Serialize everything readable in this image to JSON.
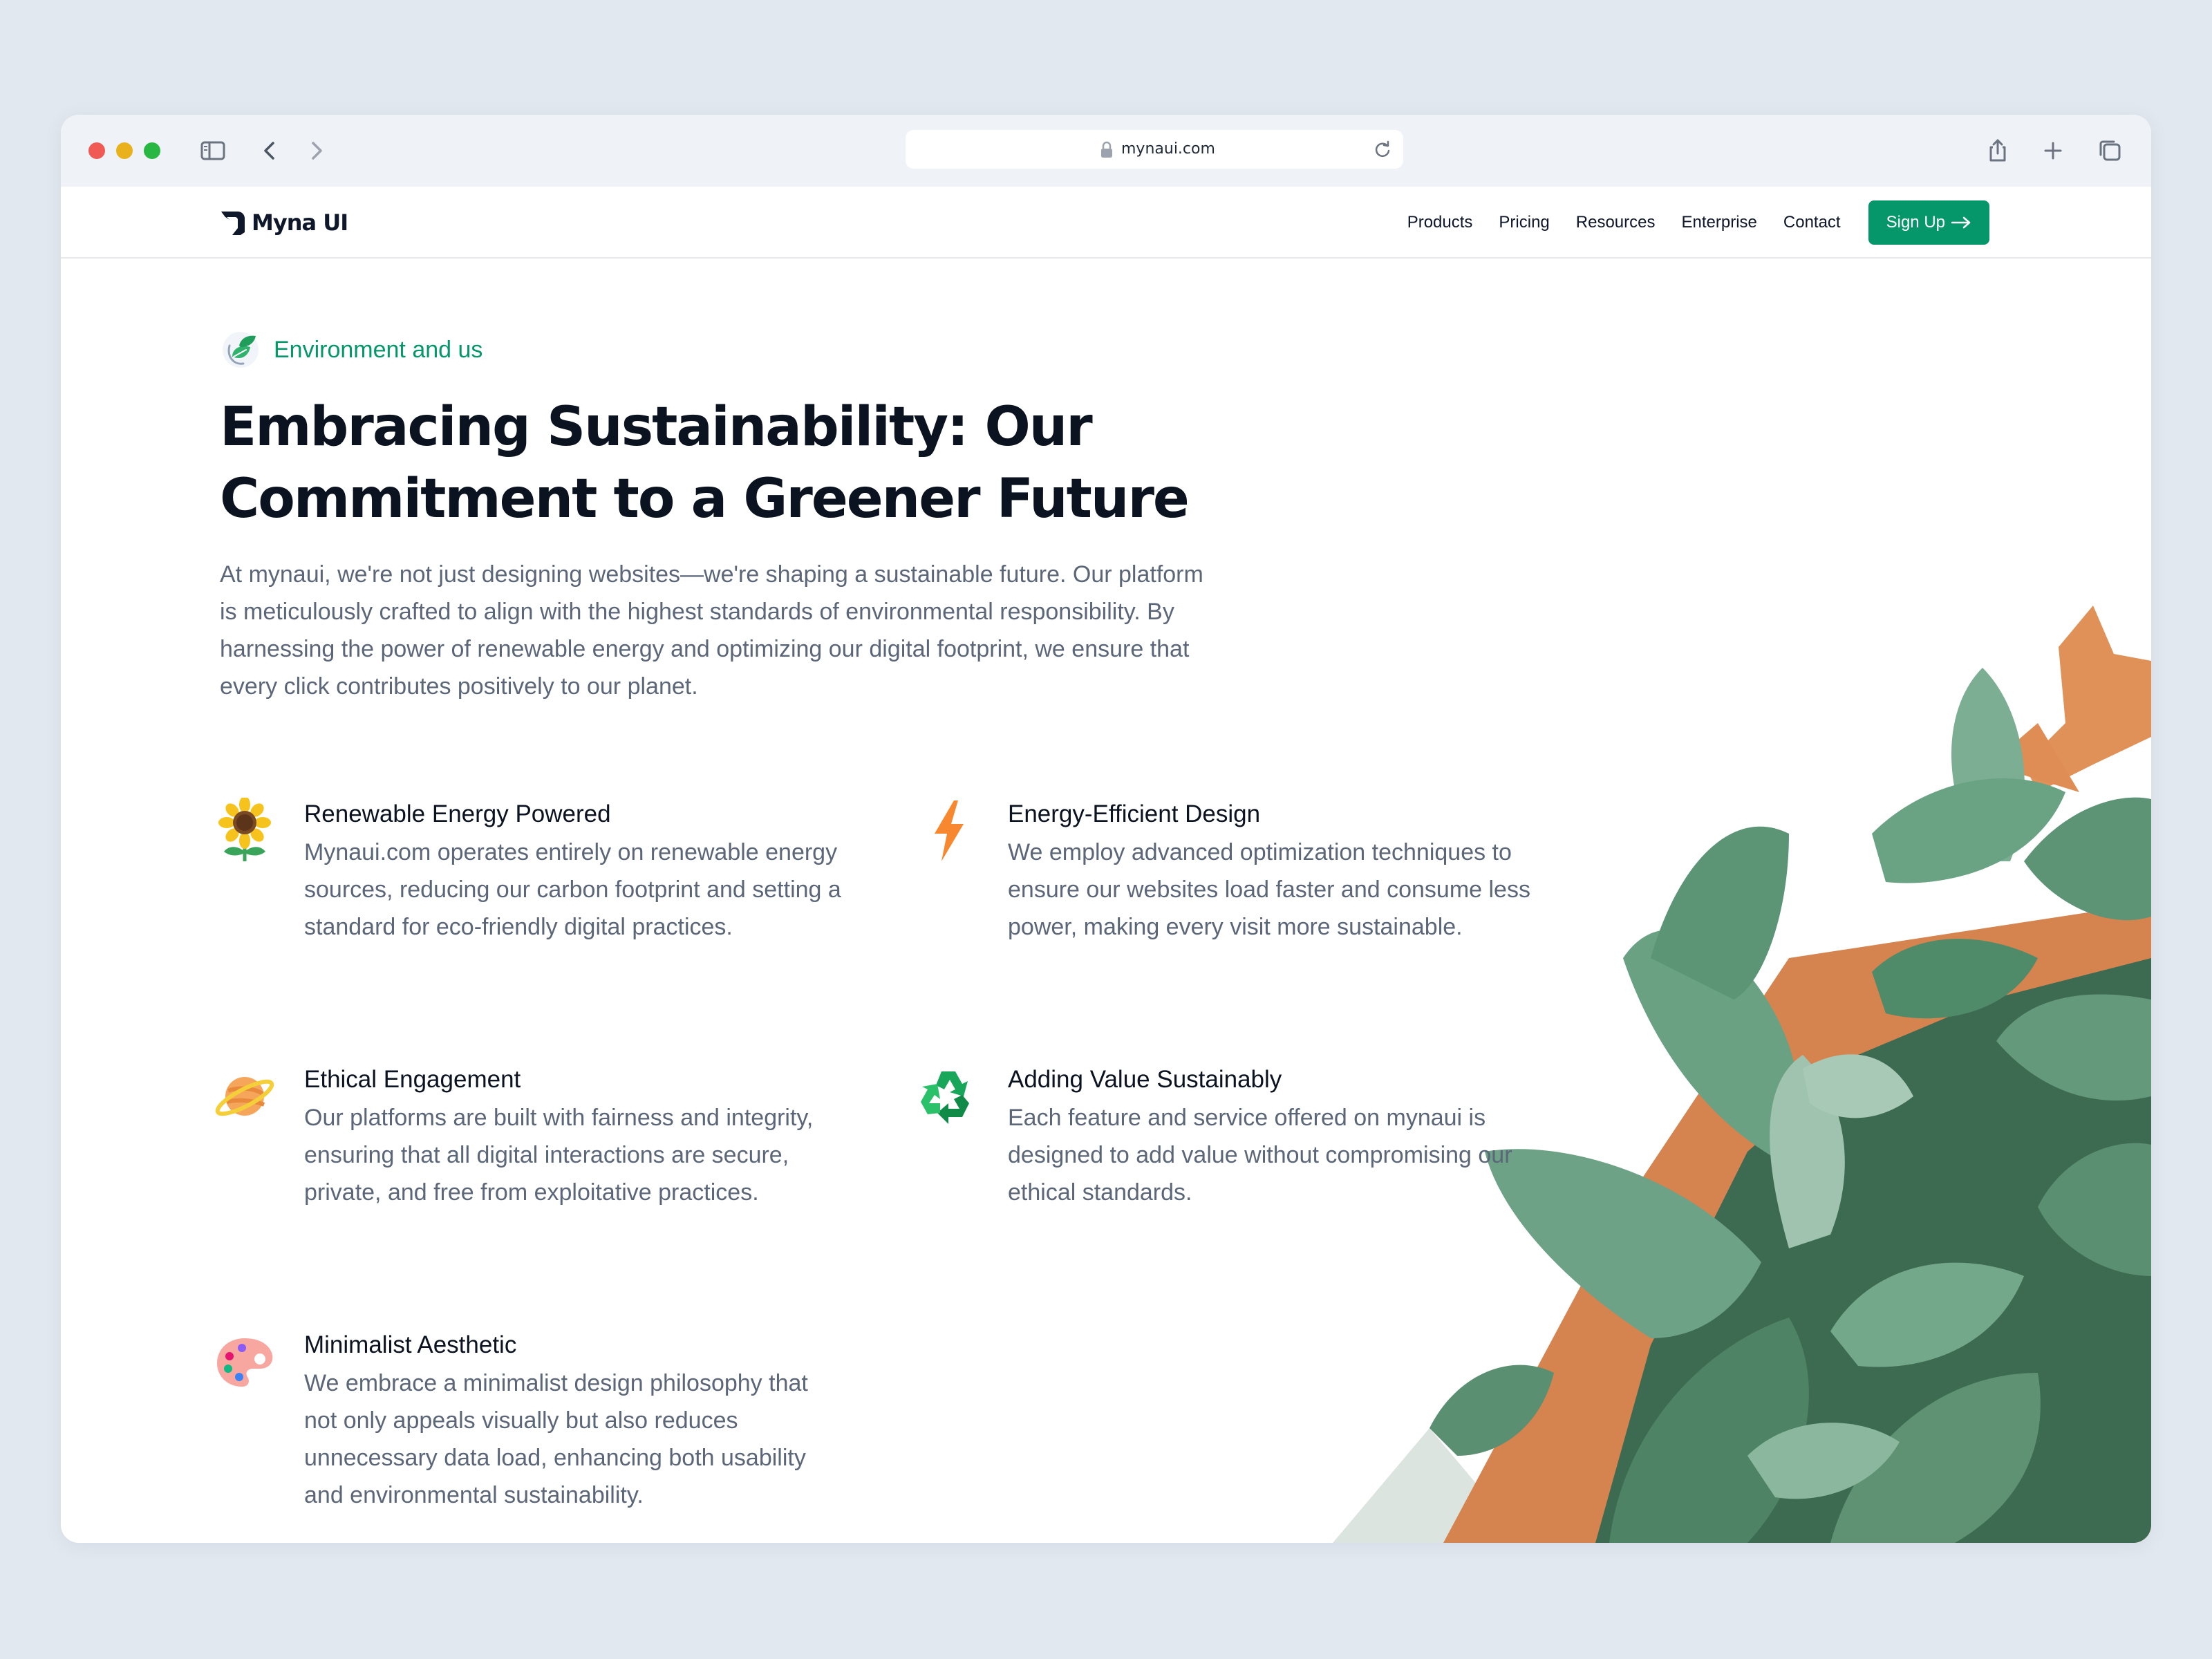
{
  "browser": {
    "url": "mynaui.com",
    "traffic_lights": [
      "#ef5a55",
      "#e9b21d",
      "#29b743"
    ]
  },
  "nav": {
    "brand": "Myna UI",
    "links": [
      "Products",
      "Pricing",
      "Resources",
      "Enterprise",
      "Contact"
    ],
    "cta": "Sign Up"
  },
  "hero": {
    "eyebrow": "Environment and us",
    "title_line1": "Embracing Sustainability: Our",
    "title_line2": "Commitment to a Greener Future",
    "intro": "At mynaui, we're not just designing websites—we're shaping a sustainable future. Our platform is meticulously crafted to align with the highest standards of environmental responsibility. By harnessing the power of renewable energy and optimizing our digital footprint, we ensure that every click contributes positively to our planet."
  },
  "features": [
    {
      "icon": "sunflower-icon",
      "title": "Renewable Energy Powered",
      "description": "Mynaui.com operates entirely on renewable energy sources, reducing our carbon footprint and setting a standard for eco-friendly digital practices."
    },
    {
      "icon": "lightning-icon",
      "title": "Energy-Efficient Design",
      "description": "We employ advanced optimization techniques to ensure our websites load faster and consume less power, making every visit more sustainable."
    },
    {
      "icon": "planet-icon",
      "title": "Ethical Engagement",
      "description": "Our platforms are built with fairness and integrity, ensuring that all digital interactions are secure, private, and free from exploitative practices."
    },
    {
      "icon": "recycle-icon",
      "title": "Adding Value Sustainably",
      "description": "Each feature and service offered on mynaui is designed to add value without compromising our ethical standards."
    },
    {
      "icon": "palette-icon",
      "title": "Minimalist Aesthetic",
      "description": "We embrace a minimalist design philosophy that not only appeals visually but also reduces unnecessary data load, enhancing both usability and environmental sustainability."
    }
  ],
  "colors": {
    "accent": "#059669",
    "heading": "#0b1220",
    "body_text": "#5b6678",
    "page_background": "#e2e8f0"
  }
}
